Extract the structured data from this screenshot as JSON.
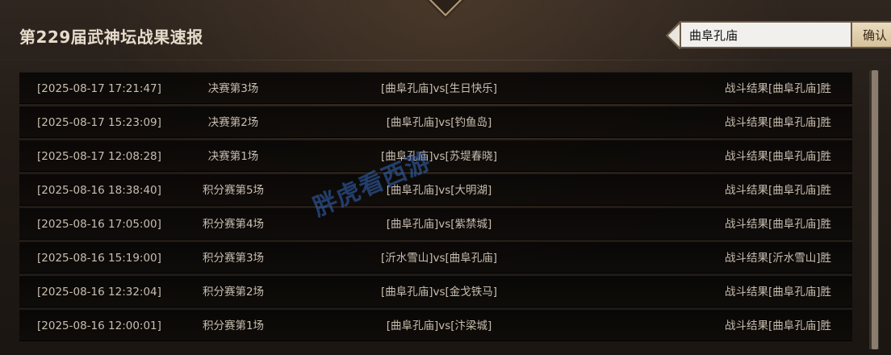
{
  "header": {
    "title": "第229届武神坛战果速报",
    "search": {
      "value": "曲阜孔庙",
      "button_label": "确认"
    }
  },
  "results": [
    {
      "time": "[2025-08-17 17:21:47]",
      "match": "决赛第3场",
      "teams": "[曲阜孔庙]vs[生日快乐]",
      "result": "战斗结果[曲阜孔庙]胜"
    },
    {
      "time": "[2025-08-17 15:23:09]",
      "match": "决赛第2场",
      "teams": "[曲阜孔庙]vs[钓鱼岛]",
      "result": "战斗结果[曲阜孔庙]胜"
    },
    {
      "time": "[2025-08-17 12:08:28]",
      "match": "决赛第1场",
      "teams": "[曲阜孔庙]vs[苏堤春晓]",
      "result": "战斗结果[曲阜孔庙]胜"
    },
    {
      "time": "[2025-08-16 18:38:40]",
      "match": "积分赛第5场",
      "teams": "[曲阜孔庙]vs[大明湖]",
      "result": "战斗结果[曲阜孔庙]胜"
    },
    {
      "time": "[2025-08-16 17:05:00]",
      "match": "积分赛第4场",
      "teams": "[曲阜孔庙]vs[紫禁城]",
      "result": "战斗结果[曲阜孔庙]胜"
    },
    {
      "time": "[2025-08-16 15:19:00]",
      "match": "积分赛第3场",
      "teams": "[沂水雪山]vs[曲阜孔庙]",
      "result": "战斗结果[沂水雪山]胜"
    },
    {
      "time": "[2025-08-16 12:32:04]",
      "match": "积分赛第2场",
      "teams": "[曲阜孔庙]vs[金戈铁马]",
      "result": "战斗结果[曲阜孔庙]胜"
    },
    {
      "time": "[2025-08-16 12:00:01]",
      "match": "积分赛第1场",
      "teams": "[曲阜孔庙]vs[汴梁城]",
      "result": "战斗结果[曲阜孔庙]胜"
    }
  ],
  "watermark": "胖虎看西游",
  "colors": {
    "background": "#221b16",
    "row_background": "#0e0b09",
    "text": "#c9beb0",
    "title": "#e7dccb",
    "button_bg": "#d6c29c",
    "scrollbar_thumb": "#8a7c6e",
    "watermark": "#3569be"
  },
  "icons": {
    "top_ornament": "diamond-ornament-icon",
    "search_pointer": "arrow-left-icon"
  }
}
